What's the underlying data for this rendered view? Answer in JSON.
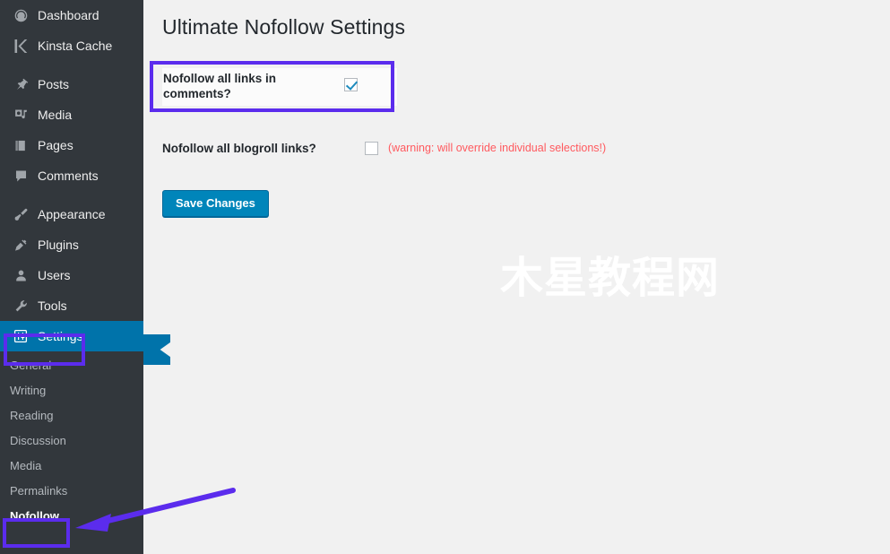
{
  "sidebar": {
    "groups": [
      {
        "items": [
          {
            "label": "Dashboard",
            "icon": "dashboard-icon",
            "name": "sidebar-item-dashboard"
          },
          {
            "label": "Kinsta Cache",
            "icon": "kinsta-k-icon",
            "name": "sidebar-item-kinsta-cache"
          }
        ]
      },
      {
        "items": [
          {
            "label": "Posts",
            "icon": "pin-icon",
            "name": "sidebar-item-posts"
          },
          {
            "label": "Media",
            "icon": "media-icon",
            "name": "sidebar-item-media"
          },
          {
            "label": "Pages",
            "icon": "page-icon",
            "name": "sidebar-item-pages"
          },
          {
            "label": "Comments",
            "icon": "comment-bubble-icon",
            "name": "sidebar-item-comments"
          }
        ]
      },
      {
        "items": [
          {
            "label": "Appearance",
            "icon": "paintbrush-icon",
            "name": "sidebar-item-appearance"
          },
          {
            "label": "Plugins",
            "icon": "plug-icon",
            "name": "sidebar-item-plugins"
          },
          {
            "label": "Users",
            "icon": "user-icon",
            "name": "sidebar-item-users"
          },
          {
            "label": "Tools",
            "icon": "wrench-icon",
            "name": "sidebar-item-tools"
          },
          {
            "label": "Settings",
            "icon": "sliders-icon",
            "name": "sidebar-item-settings",
            "current": true
          }
        ]
      }
    ],
    "submenu": [
      {
        "label": "General",
        "name": "submenu-item-general"
      },
      {
        "label": "Writing",
        "name": "submenu-item-writing"
      },
      {
        "label": "Reading",
        "name": "submenu-item-reading"
      },
      {
        "label": "Discussion",
        "name": "submenu-item-discussion"
      },
      {
        "label": "Media",
        "name": "submenu-item-media"
      },
      {
        "label": "Permalinks",
        "name": "submenu-item-permalinks"
      },
      {
        "label": "Nofollow",
        "name": "submenu-item-nofollow",
        "current": true
      }
    ]
  },
  "main": {
    "page_title": "Ultimate Nofollow Settings",
    "settings": [
      {
        "label": "Nofollow all links in comments?",
        "checked": true,
        "note": ""
      },
      {
        "label": "Nofollow all blogroll links?",
        "checked": false,
        "note": "(warning: will override individual selections!)"
      }
    ],
    "save_label": "Save Changes",
    "watermark": "木星教程网"
  },
  "annotations": {
    "highlight_color": "#5b2ced",
    "boxes": [
      "comments-setting-row",
      "settings-menu-item",
      "nofollow-submenu-item"
    ],
    "arrow": "points-left-to-nofollow-submenu-item"
  },
  "colors": {
    "sidebar_bg": "#32373c",
    "accent_blue": "#0073aa",
    "button_blue": "#0085ba",
    "warning_red": "#ff5a5f",
    "content_bg": "#f1f1f1"
  }
}
